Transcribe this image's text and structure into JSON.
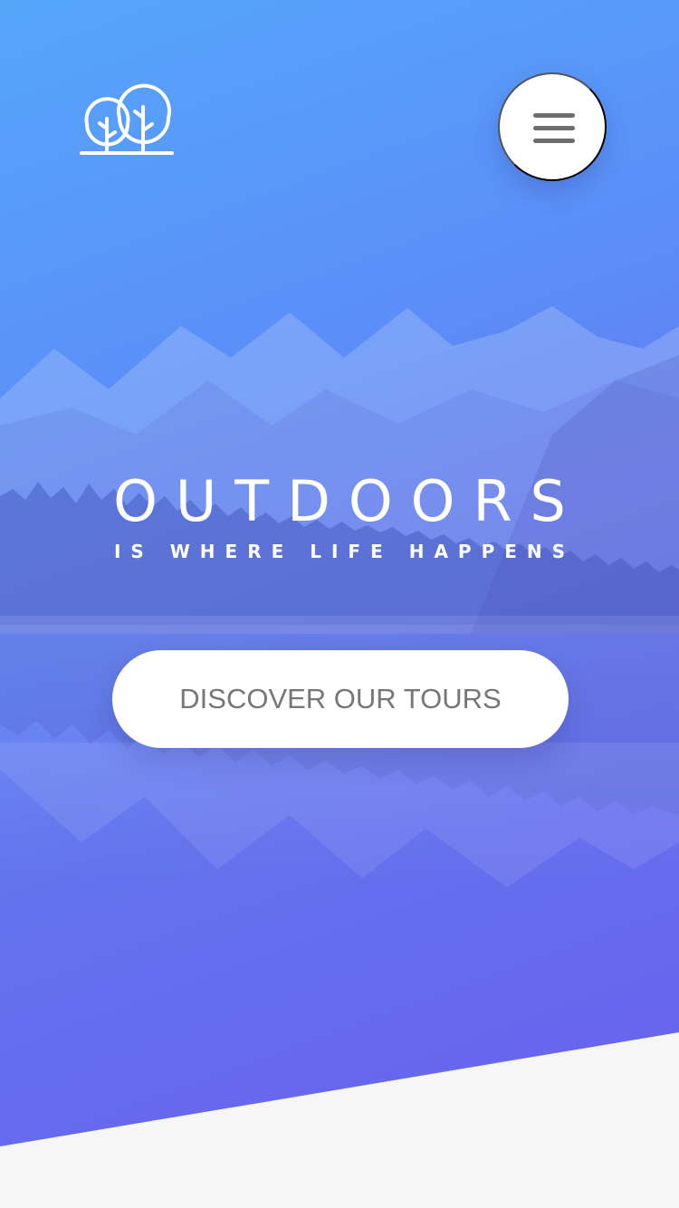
{
  "header": {
    "logo_icon": "trees-icon",
    "menu_icon": "hamburger-menu-icon"
  },
  "hero": {
    "title": "OUTDOORS",
    "subtitle": "IS WHERE LIFE HAPPENS",
    "cta_label": "DISCOVER OUR TOURS",
    "background": "mountain-lake-photo"
  },
  "colors": {
    "gradient_start": "#55a6fb",
    "gradient_end": "#6a5eee",
    "button_background": "#ffffff",
    "button_text": "#777777",
    "footer_background": "#f6f6f6"
  }
}
